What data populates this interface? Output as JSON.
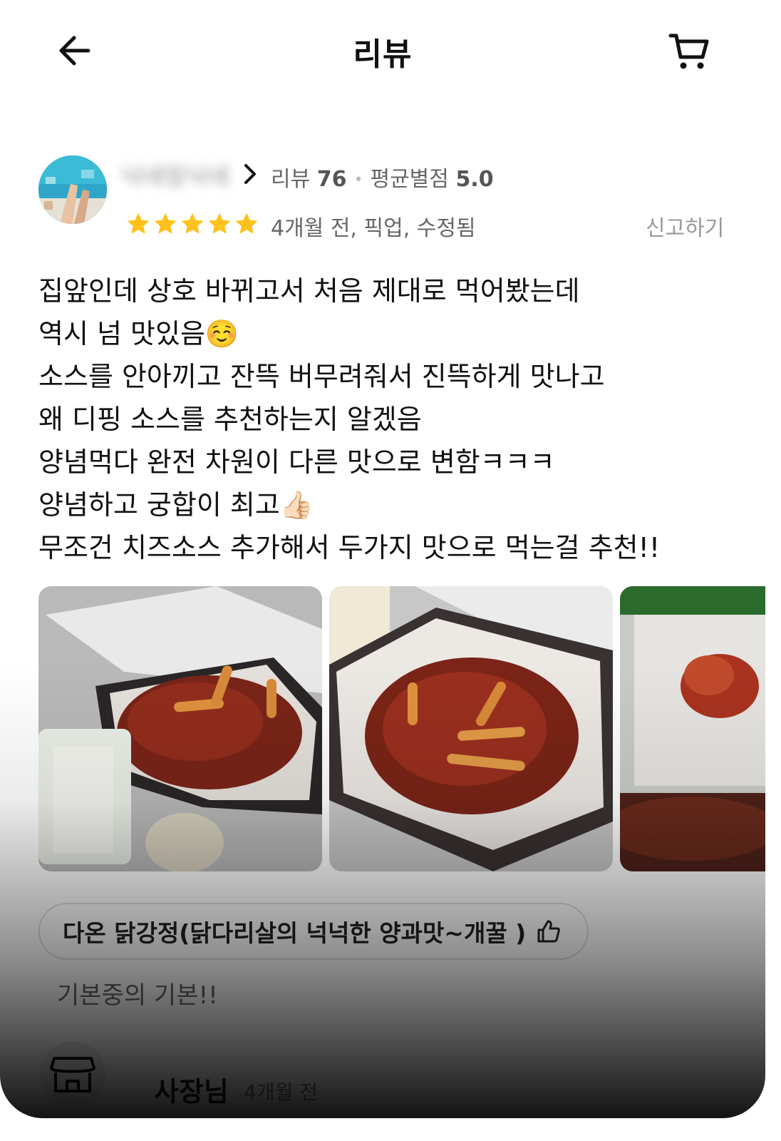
{
  "header": {
    "title": "리뷰"
  },
  "reviewer": {
    "nickname": "닉네임닉네",
    "review_count_label": "리뷰",
    "review_count": "76",
    "avg_label": "평균별점",
    "avg_rating": "5.0",
    "rating": 5,
    "meta": "4개월 전, 픽업, 수정됨",
    "report_label": "신고하기"
  },
  "review": {
    "lines": [
      "집앞인데 상호 바뀌고서 처음 제대로 먹어봤는데",
      "역시 넘 맛있음☺️",
      "소스를 안아끼고 잔뜩 버무려줘서 진뜩하게 맛나고",
      "왜 디핑 소스를 추천하는지 알겠음",
      "양념먹다 완전 차원이 다른 맛으로 변함ㅋㅋㅋ",
      "양념하고 궁합이 최고👍🏻",
      "무조건 치즈소스 추가해서 두가지 맛으로 먹는걸 추천!!"
    ]
  },
  "menu": {
    "name": "다온 닭강정(닭다리살의 넉넉한 양과맛~개꿀 )",
    "subtext": "기본중의 기본!!"
  },
  "owner": {
    "name": "사장님",
    "time": "4개월 전"
  },
  "colors": {
    "star": "#FFC21C",
    "accent": "#111111"
  }
}
